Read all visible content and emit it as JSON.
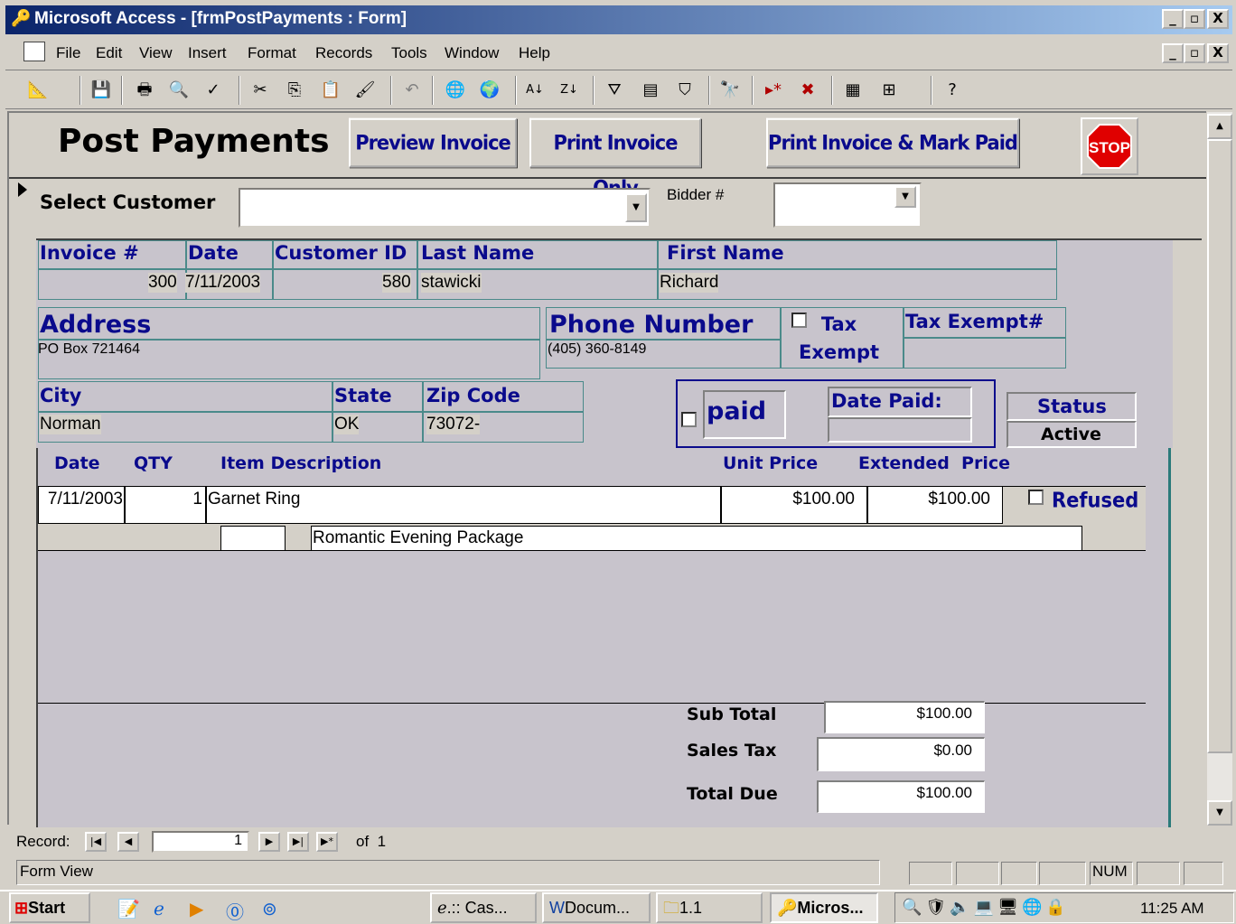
{
  "window": {
    "title": "Microsoft Access - [frmPostPayments : Form]",
    "minimize": "_",
    "restore": " ",
    "close": "X"
  },
  "menu": [
    "File",
    "Edit",
    "View",
    "Insert",
    "Format",
    "Records",
    "Tools",
    "Window",
    "Help"
  ],
  "toolbar_icons": [
    "design-view-icon",
    "save-icon",
    "print-icon",
    "print-preview-icon",
    "spelling-icon",
    "cut-icon",
    "copy-icon",
    "paste-icon",
    "format-painter-icon",
    "undo-icon",
    "insert-hyperlink-icon",
    "web-toolbar-icon",
    "sort-ascending-icon",
    "sort-descending-icon",
    "filter-by-selection-icon",
    "filter-by-form-icon",
    "apply-filter-icon",
    "find-icon",
    "new-record-icon",
    "delete-record-icon",
    "properties-icon",
    "new-object-icon",
    "help-icon"
  ],
  "form": {
    "title": "Post Payments",
    "buttons": {
      "preview": "Preview Invoice",
      "print_only": "Print Invoice Only",
      "print_mark": "Print Invoice & Mark Paid",
      "stop": "STOP"
    },
    "select_customer_label": "Select Customer",
    "bidder_label": "Bidder #",
    "invoice": {
      "headers": {
        "invoice": "Invoice #",
        "date": "Date",
        "customer_id": "Customer ID",
        "last_name": "Last Name",
        "first_name": "First Name"
      },
      "values": {
        "invoice": "300",
        "date": "7/11/2003",
        "customer_id": "580",
        "last_name": "stawicki",
        "first_name": "Richard"
      }
    },
    "address": {
      "label": "Address",
      "value": "PO Box 721464"
    },
    "phone": {
      "label": "Phone Number",
      "value": "(405) 360-8149"
    },
    "tax": {
      "label": "Tax\nExempt",
      "exempt_label": "Tax Exempt#"
    },
    "city": {
      "label": "City",
      "value": "Norman"
    },
    "state": {
      "label": "State",
      "value": "OK"
    },
    "zip": {
      "label": "Zip Code",
      "value": "73072-"
    },
    "paid_label": "paid",
    "date_paid_label": "Date Paid:",
    "status": {
      "label": "Status",
      "value": "Active"
    },
    "items": {
      "headers": {
        "date": "Date",
        "qty": "QTY",
        "desc": "Item Description",
        "unit": "Unit Price",
        "ext": "Extended  Price"
      },
      "rows": [
        {
          "date": "7/11/2003",
          "qty": "1",
          "desc": "Garnet Ring",
          "unit": "$100.00",
          "ext": "$100.00",
          "refused": "Refused",
          "subdesc": "Romantic Evening Package"
        }
      ]
    },
    "totals": {
      "sub_label": "Sub Total",
      "sub": "$100.00",
      "tax_label": "Sales Tax",
      "tax": "$0.00",
      "total_label": "Total Due",
      "total": "$100.00"
    }
  },
  "record_nav": {
    "label": "Record:",
    "current": "1",
    "of": "of  1"
  },
  "status_bar": {
    "view": "Form View",
    "num": "NUM"
  },
  "taskbar": {
    "start": "Start",
    "tasks": [
      ".:: Cas...",
      "Docum...",
      "1.1",
      "Micros..."
    ],
    "clock": "11:25 AM"
  }
}
